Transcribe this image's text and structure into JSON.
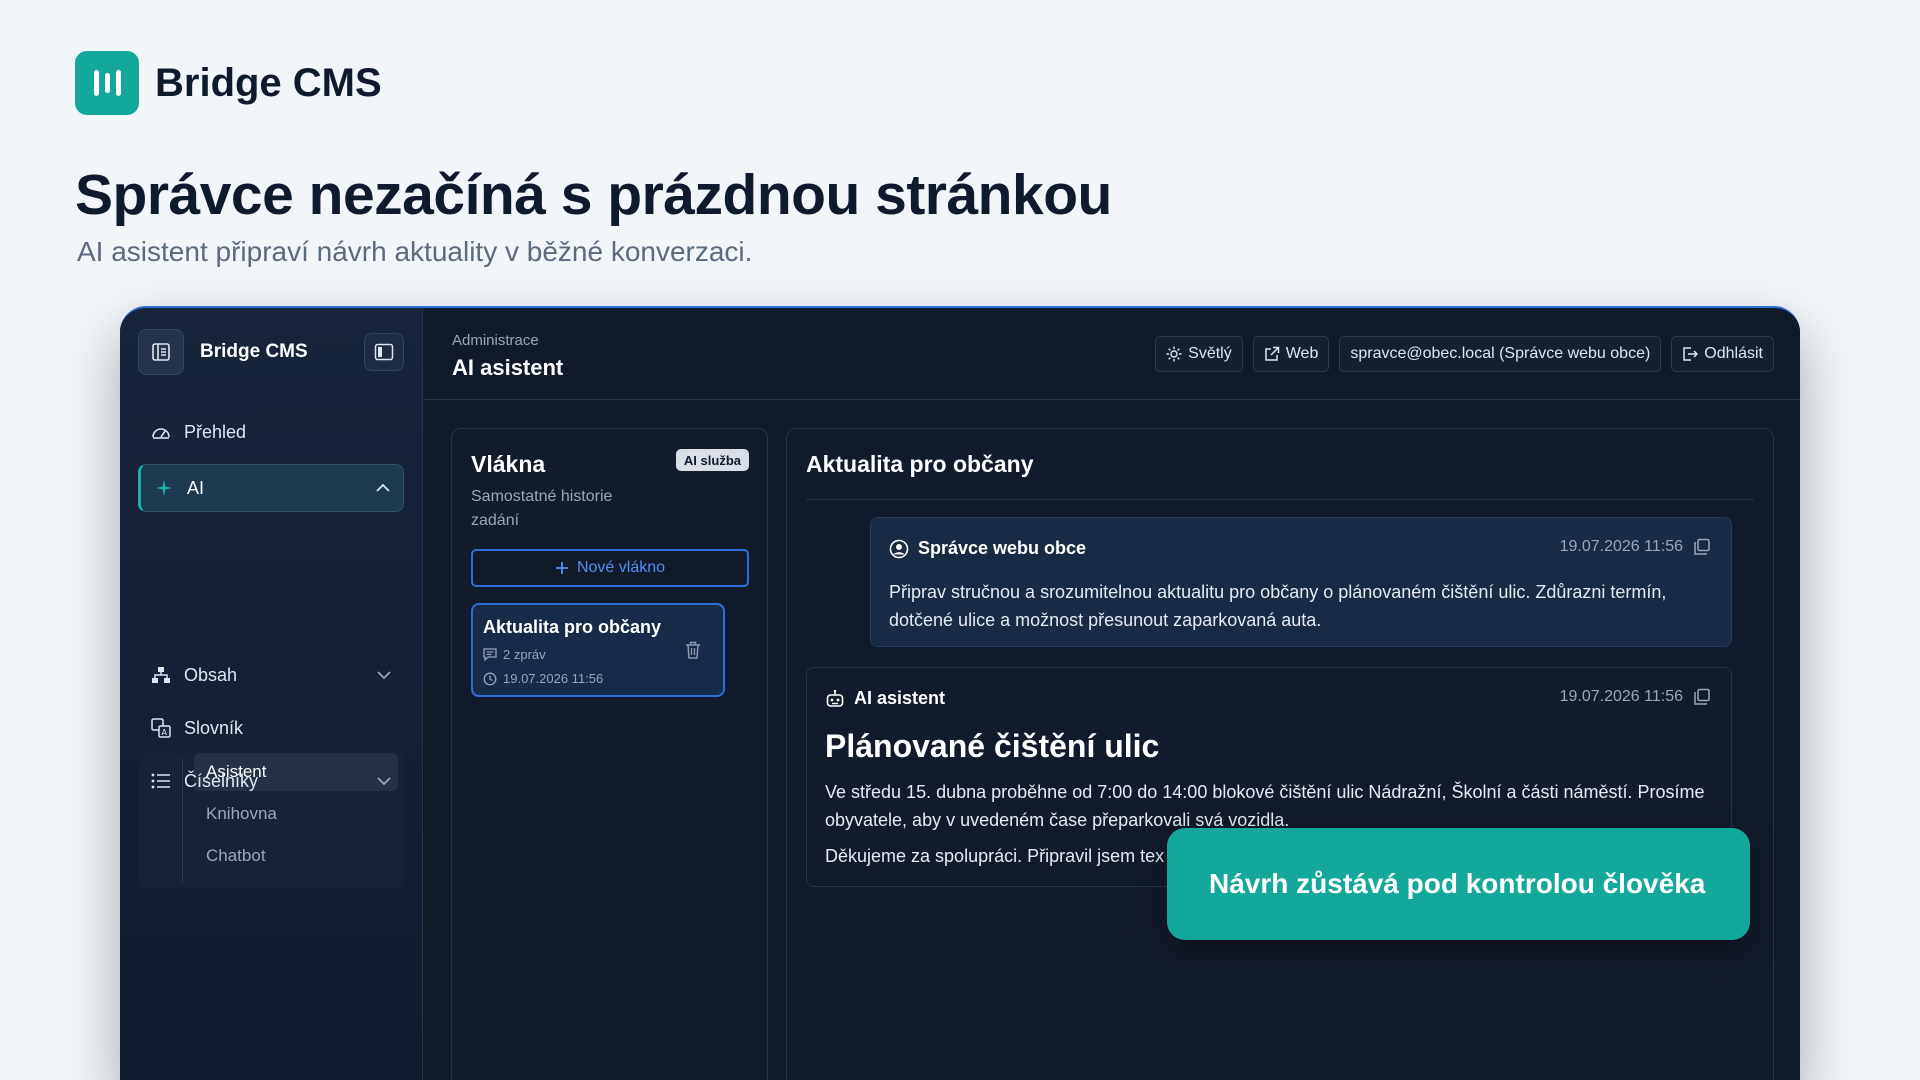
{
  "brand": {
    "name": "Bridge CMS"
  },
  "hero": {
    "headline": "Správce nezačíná s prázdnou stránkou",
    "subline": "AI asistent připraví návrh aktuality v běžné konverzaci."
  },
  "sidebar": {
    "title": "Bridge CMS",
    "items": {
      "prehled": "Přehled",
      "ai": "AI",
      "obsah": "Obsah",
      "slovnik": "Slovník",
      "ciselniky": "Číselníky"
    },
    "ai_sub": [
      "Asistent",
      "Knihovna",
      "Chatbot"
    ]
  },
  "topbar": {
    "breadcrumb": "Administrace",
    "title": "AI asistent",
    "theme_label": "Světlý",
    "web_label": "Web",
    "user_label": "spravce@obec.local (Správce webu obce)",
    "logout_label": "Odhlásit"
  },
  "threads": {
    "title": "Vlákna",
    "badge": "AI služba",
    "description": "Samostatné historie zadání",
    "new_thread_label": "Nové vlákno",
    "items": [
      {
        "title": "Aktualita pro občany",
        "messages": "2 zpráv",
        "date": "19.07.2026 11:56"
      }
    ]
  },
  "chat": {
    "title": "Aktualita pro občany",
    "user_message": {
      "author": "Správce webu obce",
      "time": "19.07.2026 11:56",
      "text": "Připrav stručnou a srozumitelnou aktualitu pro občany o plánovaném čištění ulic. Zdůrazni termín, dotčené ulice a možnost přesunout zaparkovaná auta."
    },
    "ai_message": {
      "author": "AI asistent",
      "time": "19.07.2026 11:56",
      "heading": "Plánované čištění ulic",
      "paragraph1": "Ve středu 15. dubna proběhne od 7:00 do 14:00 blokové čištění ulic Nádražní, Školní a části náměstí. Prosíme obyvatele, aby v uvedeném čase přeparkovali svá vozidla.",
      "paragraph2": "Děkujeme za spolupráci. Připravil jsem tex"
    }
  },
  "callout": {
    "text": "Návrh zůstává pod kontrolou člověka"
  },
  "colors": {
    "accent": "#14a89b",
    "primary": "#2d6fd6",
    "panel": "#111a29",
    "ink": "#0f1b2d"
  }
}
